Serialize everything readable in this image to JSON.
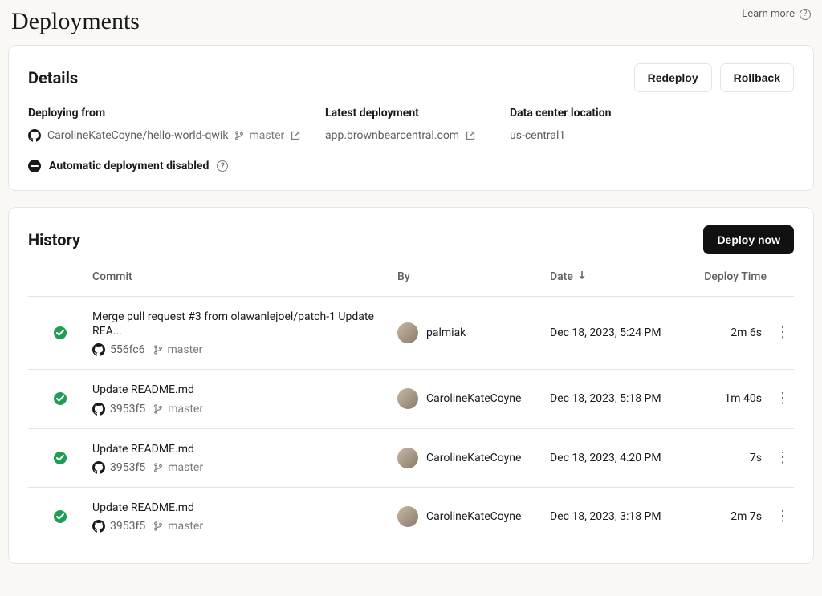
{
  "header": {
    "title": "Deployments",
    "learn_more": "Learn more"
  },
  "details": {
    "title": "Details",
    "redeploy_label": "Redeploy",
    "rollback_label": "Rollback",
    "deploying_from_label": "Deploying from",
    "repo": "CarolineKateCoyne/hello-world-qwik",
    "branch": "master",
    "latest_deployment_label": "Latest deployment",
    "latest_deployment_value": "app.brownbearcentral.com",
    "data_center_label": "Data center location",
    "data_center_value": "us-central1",
    "auto_deploy_label": "Automatic deployment disabled"
  },
  "history": {
    "title": "History",
    "deploy_now_label": "Deploy now",
    "columns": {
      "commit": "Commit",
      "by": "By",
      "date": "Date",
      "deploy_time": "Deploy Time"
    },
    "rows": [
      {
        "message": "Merge pull request #3 from olawanlejoel/patch-1 Update REA...",
        "hash": "556fc6",
        "branch": "master",
        "by": "palmiak",
        "date": "Dec 18, 2023, 5:24 PM",
        "deploy_time": "2m 6s"
      },
      {
        "message": "Update README.md",
        "hash": "3953f5",
        "branch": "master",
        "by": "CarolineKateCoyne",
        "date": "Dec 18, 2023, 5:18 PM",
        "deploy_time": "1m 40s"
      },
      {
        "message": "Update README.md",
        "hash": "3953f5",
        "branch": "master",
        "by": "CarolineKateCoyne",
        "date": "Dec 18, 2023, 4:20 PM",
        "deploy_time": "7s"
      },
      {
        "message": "Update README.md",
        "hash": "3953f5",
        "branch": "master",
        "by": "CarolineKateCoyne",
        "date": "Dec 18, 2023, 3:18 PM",
        "deploy_time": "2m 7s"
      }
    ]
  }
}
